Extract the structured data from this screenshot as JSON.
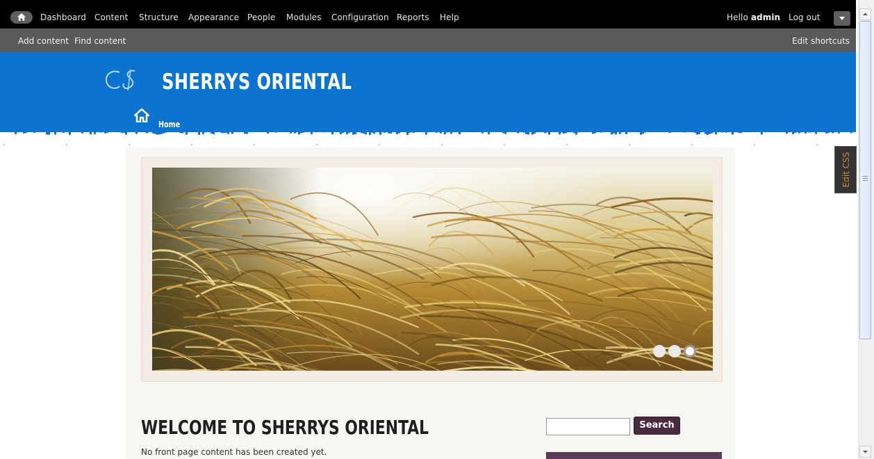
{
  "admin_toolbar": {
    "menu": [
      "Dashboard",
      "Content",
      "Structure",
      "Appearance",
      "People",
      "Modules",
      "Configuration",
      "Reports",
      "Help"
    ],
    "greeting_prefix": "Hello",
    "username": "admin",
    "logout": "Log out",
    "shortcuts": [
      "Add content",
      "Find content"
    ],
    "edit_shortcuts": "Edit shortcuts"
  },
  "header": {
    "site_name": "SHERRYS ORIENTAL",
    "nav_home": "Home"
  },
  "edit_css_tab": "Edit CSS",
  "slider": {
    "slide_count": 3,
    "active_index": 2
  },
  "content": {
    "title": "WELCOME TO SHERRYS ORIENTAL",
    "body": "No front page content has been created yet."
  },
  "search": {
    "value": "",
    "button": "Search"
  },
  "colors": {
    "header_blue": "#0c73cf",
    "toolbar_black": "#000000",
    "toolbar_gray": "#5a5a5a",
    "search_button": "#4a2a41",
    "sidebar_block": "#5a3b58"
  }
}
